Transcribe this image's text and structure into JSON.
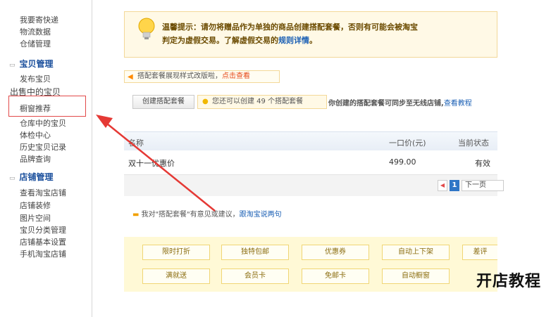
{
  "sidebar": {
    "top_items": [
      "我要寄快递",
      "物流数据",
      "仓储管理"
    ],
    "section1": {
      "title": "宝贝管理",
      "items": [
        "发布宝贝",
        "出售中的宝贝",
        "橱窗推荐",
        "仓库中的宝贝",
        "体检中心",
        "历史宝贝记录",
        "品牌查询"
      ]
    },
    "section2": {
      "title": "店铺管理",
      "items": [
        "查看淘宝店铺",
        "店铺装修",
        "图片空间",
        "宝贝分类管理",
        "店铺基本设置",
        "手机淘宝店铺"
      ]
    }
  },
  "tip": {
    "line1": "温馨提示：请勿将赠品作为单独的商品创建搭配套餐，否则有可能会被淘宝",
    "line2_prefix": "判定为虚假交易。了解虚假交易的",
    "line2_link": "规则详情",
    "line2_suffix": "。"
  },
  "notice": {
    "text": "搭配套餐展现样式改版啦，",
    "link": "点击查看"
  },
  "create": {
    "button": "创建搭配套餐",
    "quota": "您还可以创建 49 个搭配套餐",
    "sync_text": "你创建的搭配套餐可同步至无线店铺,",
    "sync_link": "查看教程"
  },
  "table": {
    "headers": [
      "名称",
      "一口价(元)",
      "当前状态"
    ],
    "rows": [
      {
        "name": "双十一优惠价",
        "price": "499.00",
        "status": "有效"
      }
    ]
  },
  "pager": {
    "prev": "◀",
    "page": "1",
    "next": "下一页"
  },
  "feedback": {
    "text": "我对\"搭配套餐\"有意见或建议，",
    "link": "跟淘宝说两句"
  },
  "tools": {
    "row1": [
      "限时打折",
      "独特包邮",
      "优惠券",
      "自动上下架",
      "差评"
    ],
    "row2": [
      "满就送",
      "会员卡",
      "免邮卡",
      "自动橱窗",
      ""
    ]
  },
  "watermark": "开店教程",
  "colors": {
    "link": "#1a5fb4",
    "accent": "#e64a19",
    "arrow": "#e53935",
    "tip_bg": "#fff9e6"
  },
  "icons": {
    "tip": "lightbulb-icon",
    "notice": "speaker-icon",
    "quota": "lightbulb-icon",
    "feedback": "chat-icon"
  }
}
